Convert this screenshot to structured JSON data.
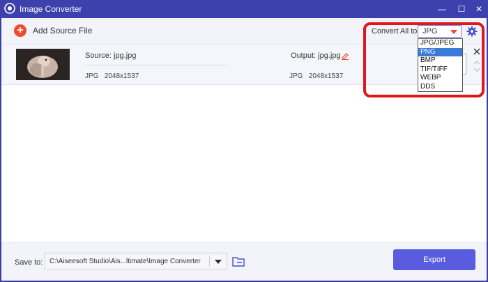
{
  "window": {
    "title": "Image Converter",
    "minimize_glyph": "—",
    "maximize_glyph": "☐",
    "close_glyph": "✕"
  },
  "toolbar": {
    "add_source_label": "Add Source File",
    "add_icon": "plus-circle-icon",
    "convert_all_label": "Convert All to:",
    "selected_format": "JPG",
    "settings_icon": "gear-icon"
  },
  "format_options": [
    "JPG/JPEG",
    "PNG",
    "BMP",
    "TIF/TIFF",
    "WEBP",
    "DDS"
  ],
  "format_options_highlighted_index": 1,
  "file": {
    "source_label": "Source: jpg.jpg",
    "source_format": "JPG",
    "source_dims": "2048x1537",
    "output_label": "Output: jpg.jpg",
    "output_format": "JPG",
    "output_dims": "2048x1537"
  },
  "footer": {
    "save_to_label": "Save to:",
    "save_path": "C:\\Aiseesoft Studio\\Ais...ltimate\\Image Converter",
    "export_label": "Export"
  },
  "colors": {
    "accent": "#5a5ce0",
    "titlebar": "#3c41ad",
    "add_icon": "#f04b2c",
    "highlight": "#e0161e",
    "selected_option": "#3b7bd8"
  }
}
